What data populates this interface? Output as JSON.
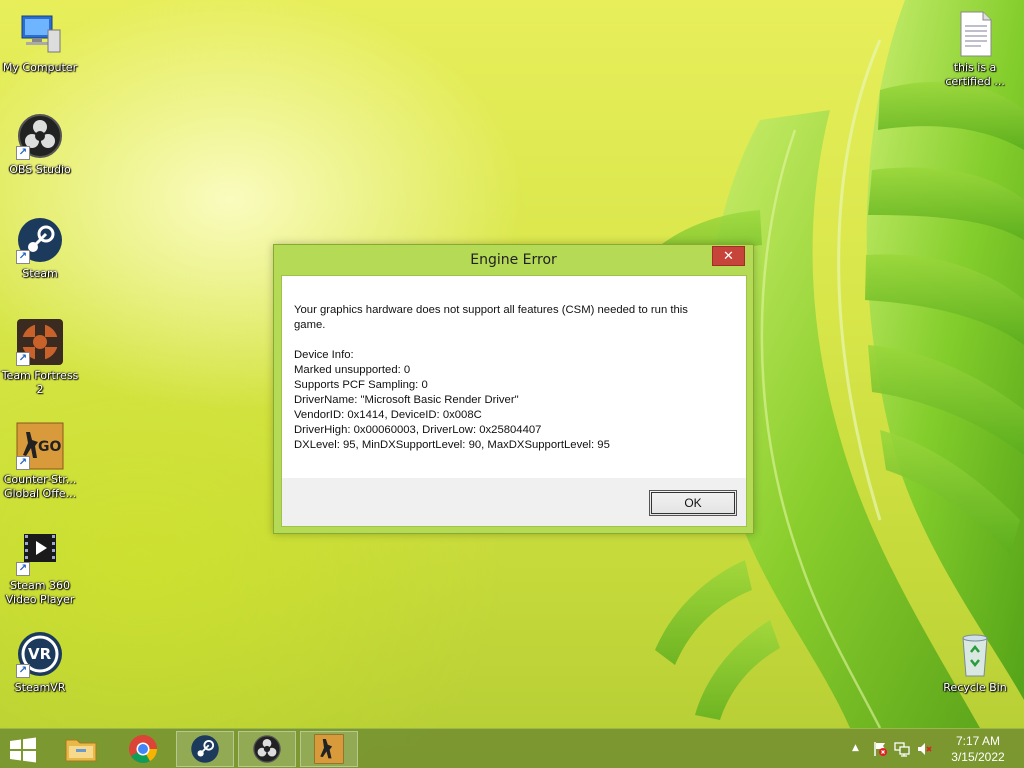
{
  "desktop": {
    "icons": [
      {
        "label": "My Computer"
      },
      {
        "label": "OBS Studio"
      },
      {
        "label": "Steam"
      },
      {
        "label": "Team Fortress 2"
      },
      {
        "label": "Counter-Str... Global Offe..."
      },
      {
        "label": "Steam 360 Video Player"
      },
      {
        "label": "SteamVR"
      },
      {
        "label": "this is a certified ..."
      },
      {
        "label": "Recycle Bin"
      }
    ],
    "csgo_badge": "GO",
    "vr_badge": "VR"
  },
  "dialog": {
    "title": "Engine Error",
    "close_glyph": "✕",
    "message_lines": [
      "Your graphics hardware does not support all features (CSM) needed to run this",
      "game."
    ],
    "device_lines": [
      "Device Info:",
      "Marked unsupported: 0",
      "Supports PCF Sampling: 0",
      "DriverName: \"Microsoft Basic Render Driver\"",
      "VendorID: 0x1414, DeviceID: 0x008C",
      "DriverHigh: 0x00060003, DriverLow: 0x25804407",
      "DXLevel: 95, MinDXSupportLevel: 90, MaxDXSupportLevel: 95"
    ],
    "ok_label": "OK"
  },
  "taskbar": {
    "pinned": [
      "start-icon",
      "file-explorer-icon",
      "chrome-icon",
      "steam-icon",
      "obs-icon",
      "csgo-icon"
    ],
    "tray_chevron": "▲",
    "time": "7:17 AM",
    "date": "3/15/2022"
  },
  "colors": {
    "dialog_frame": "#b5da55",
    "close_button": "#c7443a",
    "taskbar": "#769230"
  }
}
